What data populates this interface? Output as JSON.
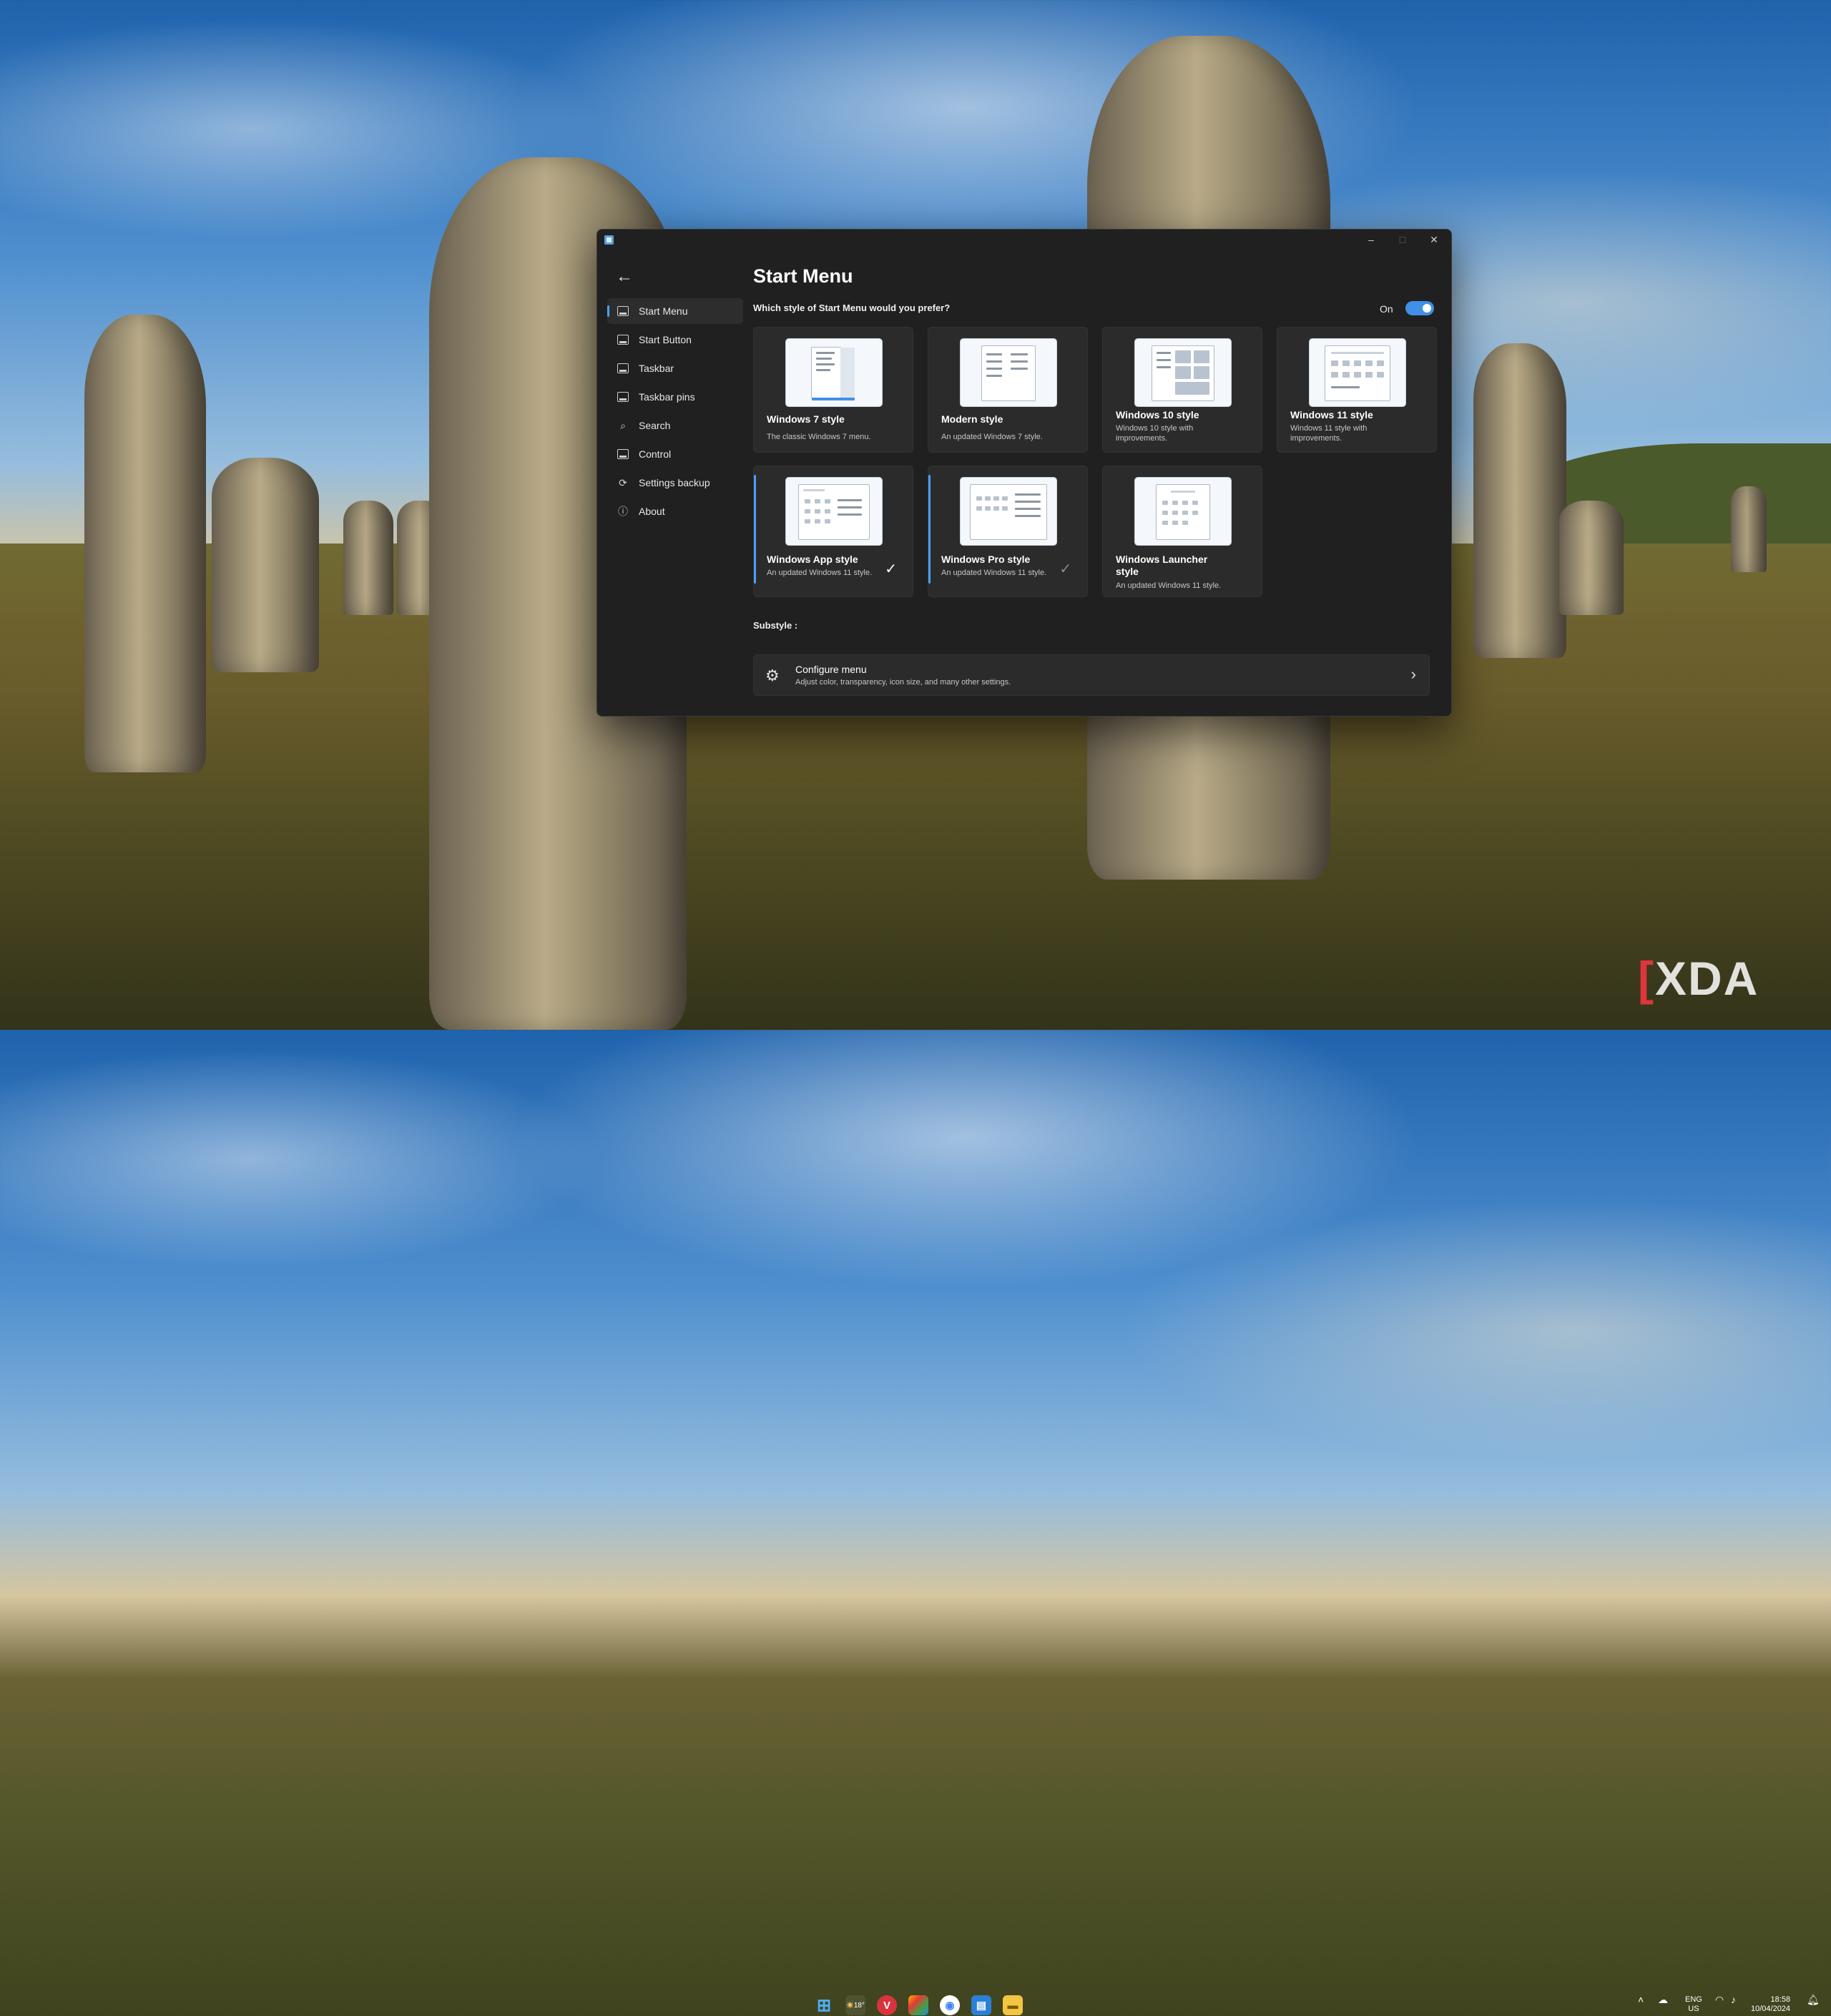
{
  "window": {
    "title_icon": "app-icon",
    "controls": {
      "minimize": "–",
      "maximize": "□",
      "close": "✕"
    }
  },
  "sidebar": {
    "items": [
      {
        "label": "Start Menu",
        "icon": "start-menu-icon",
        "active": true
      },
      {
        "label": "Start Button",
        "icon": "start-button-icon"
      },
      {
        "label": "Taskbar",
        "icon": "taskbar-icon"
      },
      {
        "label": "Taskbar pins",
        "icon": "taskbar-pins-icon"
      },
      {
        "label": "Search",
        "icon": "search-icon"
      },
      {
        "label": "Control",
        "icon": "control-icon"
      },
      {
        "label": "Settings backup",
        "icon": "sync-icon"
      },
      {
        "label": "About",
        "icon": "info-icon"
      }
    ]
  },
  "main": {
    "title": "Start Menu",
    "question": "Which style of Start Menu would you prefer?",
    "toggle": {
      "label": "On",
      "state": true,
      "color": "#3f90e6"
    },
    "styles": [
      {
        "title": "Windows 7 style",
        "desc": "The classic Windows 7 menu."
      },
      {
        "title": "Modern style",
        "desc": "An updated Windows 7 style."
      },
      {
        "title": "Windows 10 style",
        "desc": "Windows 10 style with improvements."
      },
      {
        "title": "Windows 11 style",
        "desc": "Windows 11 style with improvements."
      },
      {
        "title": "Windows App style",
        "desc": "An updated Windows 11 style.",
        "selected": true,
        "checked": true
      },
      {
        "title": "Windows Pro style",
        "desc": "An updated Windows 11 style.",
        "selected": true,
        "checked": "dim"
      },
      {
        "title": "Windows Launcher style",
        "desc": "An updated Windows 11 style."
      }
    ],
    "substyle_label": "Substyle :",
    "configure": {
      "title": "Configure menu",
      "desc": "Adjust color, transparency, icon size, and many other settings."
    }
  },
  "taskbar": {
    "weather": "18°",
    "lang_line1": "ENG",
    "lang_line2": "US",
    "time": "18:58",
    "date": "10/04/2024"
  },
  "watermark": "XDA",
  "accent": "#4aa0ff"
}
